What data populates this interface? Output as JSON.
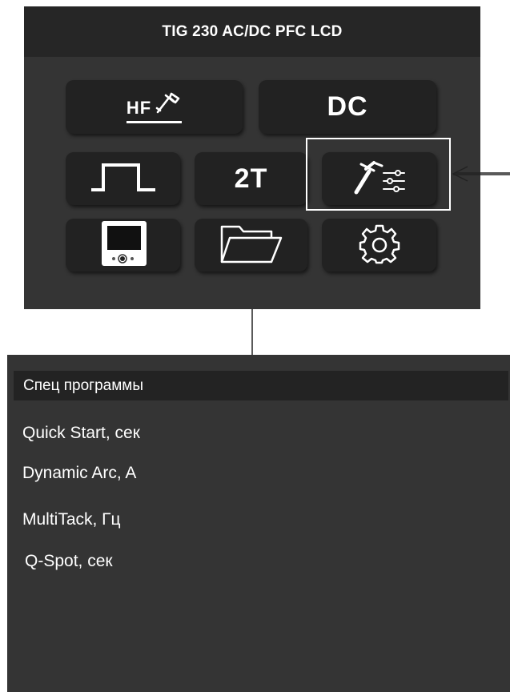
{
  "panel": {
    "title": "TIG 230 AC/DC PFC LCD",
    "tiles": {
      "hf": {
        "label": "HF",
        "icon": "torch-icon"
      },
      "current": {
        "label": "DC"
      },
      "waveform": {
        "icon": "square-wave-icon"
      },
      "trigger": {
        "label": "2T"
      },
      "special_programs": {
        "icon": "torch-settings-icon",
        "highlighted": true
      },
      "display": {
        "icon": "display-icon"
      },
      "folder": {
        "icon": "folder-icon"
      },
      "settings": {
        "icon": "gear-icon"
      }
    }
  },
  "menu": {
    "title": "Спец программы",
    "items": [
      {
        "label": "Quick Start, сек"
      },
      {
        "label": "Dynamic Arc, A"
      },
      {
        "label": "MultiTack, Гц"
      },
      {
        "label": "Q-Spot, сек"
      }
    ]
  },
  "colors": {
    "panel_bg": "#343434",
    "title_bg": "#262626",
    "tile_bg": "#222222",
    "text": "#ffffff"
  }
}
